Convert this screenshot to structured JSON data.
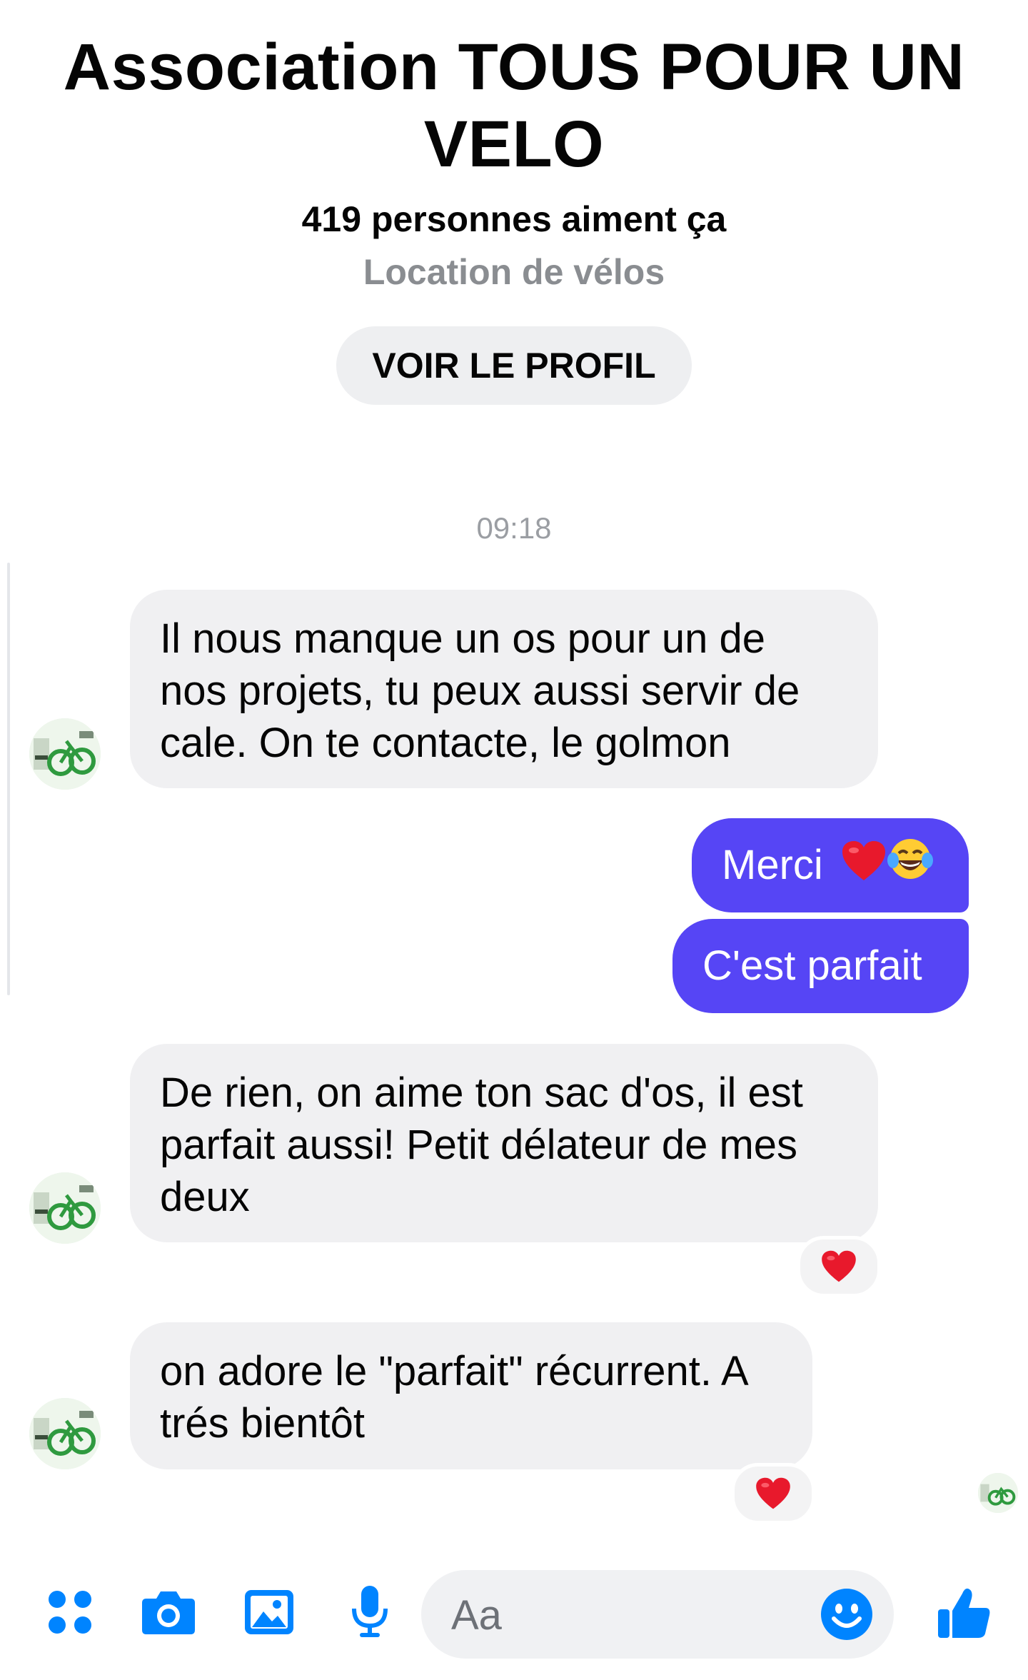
{
  "header": {
    "title": "Association TOUS POUR UN VELO",
    "likes": "419 personnes aiment ça",
    "category": "Location de vélos",
    "profile_button": "VOIR LE PROFIL"
  },
  "conversation": {
    "timestamp": "09:18",
    "messages": [
      {
        "from": "page",
        "lines": [
          "Il nous manque un os pour un de",
          "nos projets, tu peux aussi servir de",
          "cale. On te contacte, le golmon"
        ]
      },
      {
        "from": "me",
        "text": "Merci",
        "emojis": [
          "heart-emoji",
          "tears-of-joy-emoji"
        ]
      },
      {
        "from": "me",
        "text": "C'est parfait"
      },
      {
        "from": "page",
        "lines": [
          "De rien, on aime ton sac d'os, il est",
          "parfait aussi! Petit délateur de mes",
          "deux"
        ],
        "reaction": "heart-emoji"
      },
      {
        "from": "page",
        "lines": [
          "on adore le \"parfait\" récurrent. A",
          "trés bientôt"
        ],
        "reaction": "heart-emoji"
      }
    ]
  },
  "composer": {
    "placeholder": "Aa"
  },
  "colors": {
    "accent": "#0084ff",
    "outgoing_bubble": "#5645f5",
    "incoming_bubble": "#f0f0f2",
    "heart": "#e8192c"
  }
}
